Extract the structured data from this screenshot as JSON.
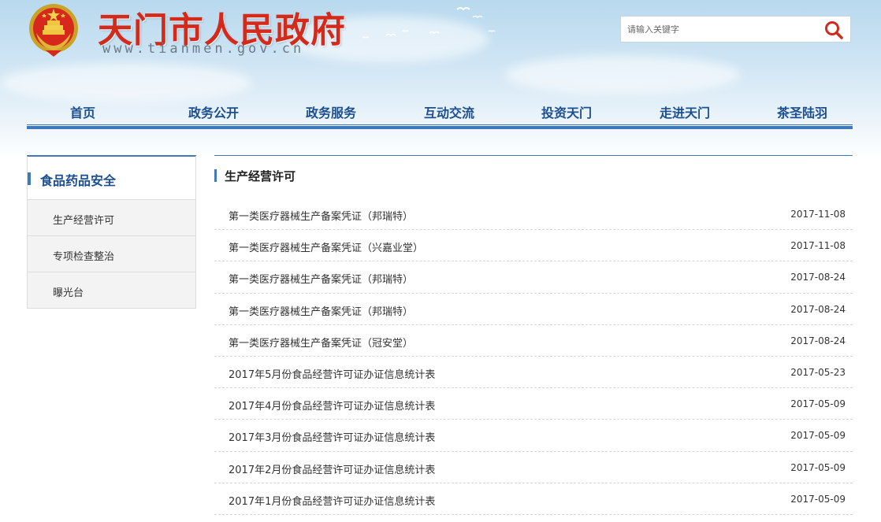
{
  "header": {
    "site_title": "天门市人民政府",
    "site_url": "www.tianmen.gov.cn",
    "search_placeholder": "请输入关键字"
  },
  "nav": [
    {
      "label": "首页"
    },
    {
      "label": "政务公开"
    },
    {
      "label": "政务服务"
    },
    {
      "label": "互动交流"
    },
    {
      "label": "投资天门"
    },
    {
      "label": "走进天门"
    },
    {
      "label": "茶圣陆羽"
    }
  ],
  "sidebar": {
    "title": "食品药品安全",
    "items": [
      {
        "label": "生产经营许可"
      },
      {
        "label": "专项检查整治"
      },
      {
        "label": "曝光台"
      }
    ]
  },
  "main": {
    "title": "生产经营许可",
    "items": [
      {
        "title": "第一类医疗器械生产备案凭证（邦瑞特）",
        "date": "2017-11-08"
      },
      {
        "title": "第一类医疗器械生产备案凭证（兴嘉业堂）",
        "date": "2017-11-08"
      },
      {
        "title": "第一类医疗器械生产备案凭证（邦瑞特）",
        "date": "2017-08-24"
      },
      {
        "title": "第一类医疗器械生产备案凭证（邦瑞特）",
        "date": "2017-08-24"
      },
      {
        "title": "第一类医疗器械生产备案凭证（冠安堂）",
        "date": "2017-08-24"
      },
      {
        "title": "2017年5月份食品经营许可证办证信息统计表",
        "date": "2017-05-23"
      },
      {
        "title": "2017年4月份食品经营许可证办证信息统计表",
        "date": "2017-05-09"
      },
      {
        "title": "2017年3月份食品经营许可证办证信息统计表",
        "date": "2017-05-09"
      },
      {
        "title": "2017年2月份食品经营许可证办证信息统计表",
        "date": "2017-05-09"
      },
      {
        "title": "2017年1月份食品经营许可证办证信息统计表",
        "date": "2017-05-09"
      }
    ]
  },
  "colors": {
    "accent_blue": "#3f79b7",
    "nav_text": "#1d4f8e",
    "title_red": "#d42a1c"
  },
  "icons": {
    "emblem": "national-emblem-icon",
    "search": "search-icon"
  }
}
